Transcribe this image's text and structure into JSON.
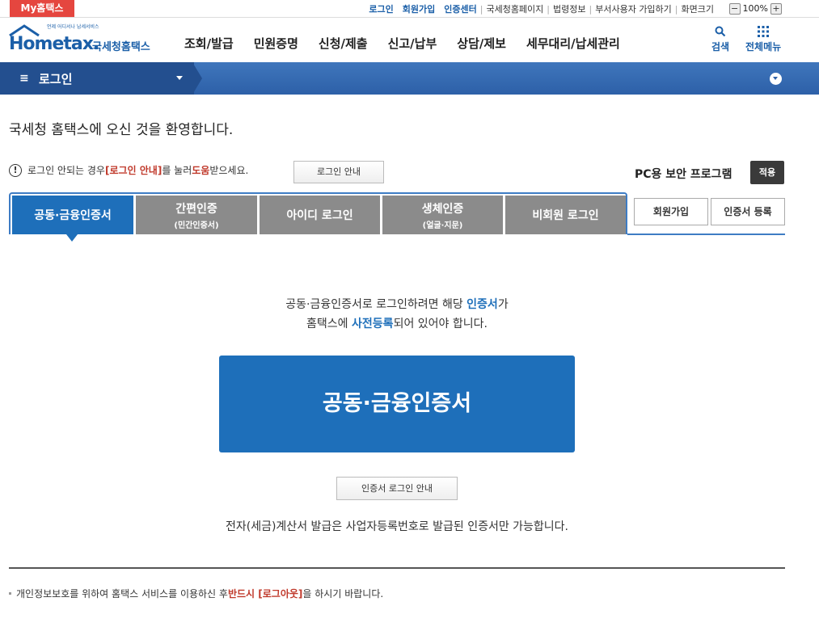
{
  "topbar": {
    "my_hometax": "My홈택스",
    "links": [
      "로그인",
      "회원가입",
      "인증센터"
    ],
    "plain_links": [
      "국세청홈페이지",
      "법령정보",
      "부서사용자 가입하기",
      "화면크기"
    ],
    "zoom_minus": "−",
    "zoom_value": "100%",
    "zoom_plus": "+"
  },
  "logo": {
    "tagline": "언제 어디서나 납세서비스",
    "main": "Hometax.",
    "sub": "국세청홈택스"
  },
  "gnb": [
    "조회/발급",
    "민원증명",
    "신청/제출",
    "신고/납부",
    "상담/제보",
    "세무대리/납세관리"
  ],
  "header_icons": {
    "search": "검색",
    "all_menu": "전체메뉴"
  },
  "navbar": {
    "menu_icon": "≡",
    "title": "로그인"
  },
  "welcome": "국세청 홈택스에 오신 것을 환영합니다.",
  "notice": {
    "pre": "로그인 안되는 경우 ",
    "bracket": "[로그인 안내]",
    "mid": "를 눌러 ",
    "help": "도움",
    "post": "받으세요.",
    "guide_button": "로그인 안내"
  },
  "pc_security": {
    "label": "PC용 보안 프로그램",
    "apply": "적용"
  },
  "tabs": [
    {
      "label": "공동·금융인증서",
      "sub": ""
    },
    {
      "label": "간편인증",
      "sub": "(민간인증서)"
    },
    {
      "label": "아이디 로그인",
      "sub": ""
    },
    {
      "label": "생체인증",
      "sub": "(얼굴·지문)"
    },
    {
      "label": "비회원 로그인",
      "sub": ""
    }
  ],
  "side_buttons": {
    "signup": "회원가입",
    "cert_register": "인증서 등록"
  },
  "content": {
    "line1_pre": "공동·금융인증서로 로그인하려면 해당 ",
    "line1_blue": "인증서",
    "line1_post": "가",
    "line2_pre": "홈택스에 ",
    "line2_blue": "사전등록",
    "line2_post": "되어 있어야 합니다.",
    "big_button": "공동·금융인증서",
    "cert_guide_button": "인증서 로그인 안내",
    "tax_note": "전자(세금)계산서 발급은 사업자등록번호로 발급된 인증서만 가능합니다."
  },
  "footer": {
    "pre": "개인정보보호를 위하여 홈택스 서비스를 이용하신 후 ",
    "red": "반드시 [로그아웃]",
    "post": "을 하시기 바랍니다."
  },
  "colors": {
    "brand_blue": "#1e6fba",
    "tab_gray": "#8b8b8b",
    "my_red": "#e5463f"
  }
}
